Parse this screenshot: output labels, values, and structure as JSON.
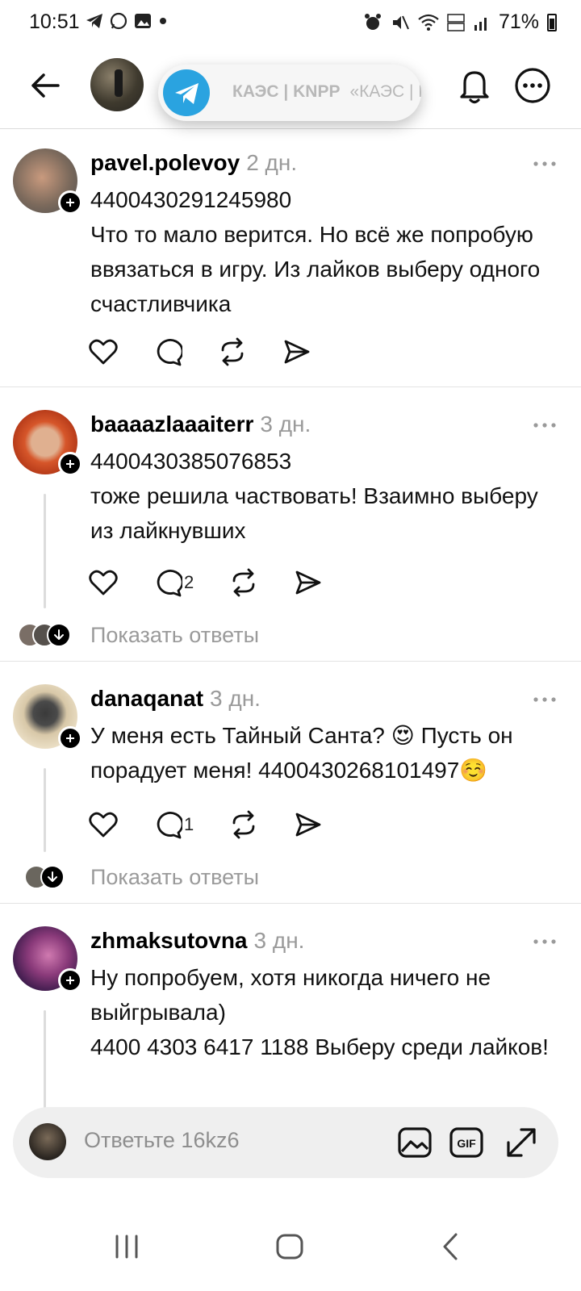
{
  "status_bar": {
    "time": "10:51",
    "battery": "71%"
  },
  "header": {
    "toast": {
      "source": "КАЭС | KNPP",
      "text": "«КАЭС | KNPP» опубликов..."
    }
  },
  "posts": [
    {
      "username": "pavel.polevoy",
      "time": "2 дн.",
      "text": "4400430291245980\nЧто то мало верится. Но всё же попробую ввязаться в игру. Из лайков выберу одного счастливчика",
      "reply_count": "",
      "show_replies": ""
    },
    {
      "username": "baaaazlaaaiterr",
      "time": "3 дн.",
      "text": "4400430385076853\nтоже решила частвовать! Взаимно выберу из лайкнувших",
      "reply_count": "2",
      "show_replies": "Показать ответы"
    },
    {
      "username": "danaqanat",
      "time": "3 дн.",
      "text": "У меня есть Тайный Санта? 😍 Пусть он порадует меня! 4400430268101497☺️",
      "reply_count": "1",
      "show_replies": "Показать ответы"
    },
    {
      "username": "zhmaksutovna",
      "time": "3 дн.",
      "text": "Ну попробуем, хотя никогда ничего не выйгрывала)\n4400 4303 6417 1188 Выберу среди лайков!",
      "reply_count": "",
      "show_replies": ""
    }
  ],
  "reply_bar": {
    "placeholder": "Ответьте 16kz6"
  },
  "icons": {
    "back": "back-arrow-icon",
    "bell": "bell-icon",
    "more": "more-icon",
    "like": "heart-icon",
    "comment": "comment-icon",
    "repost": "repost-icon",
    "share": "send-icon",
    "image": "image-icon",
    "gif": "gif-icon",
    "expand": "expand-icon"
  },
  "colors": {
    "telegram": "#2aa3e0",
    "secondary_text": "#9a9a9a"
  }
}
